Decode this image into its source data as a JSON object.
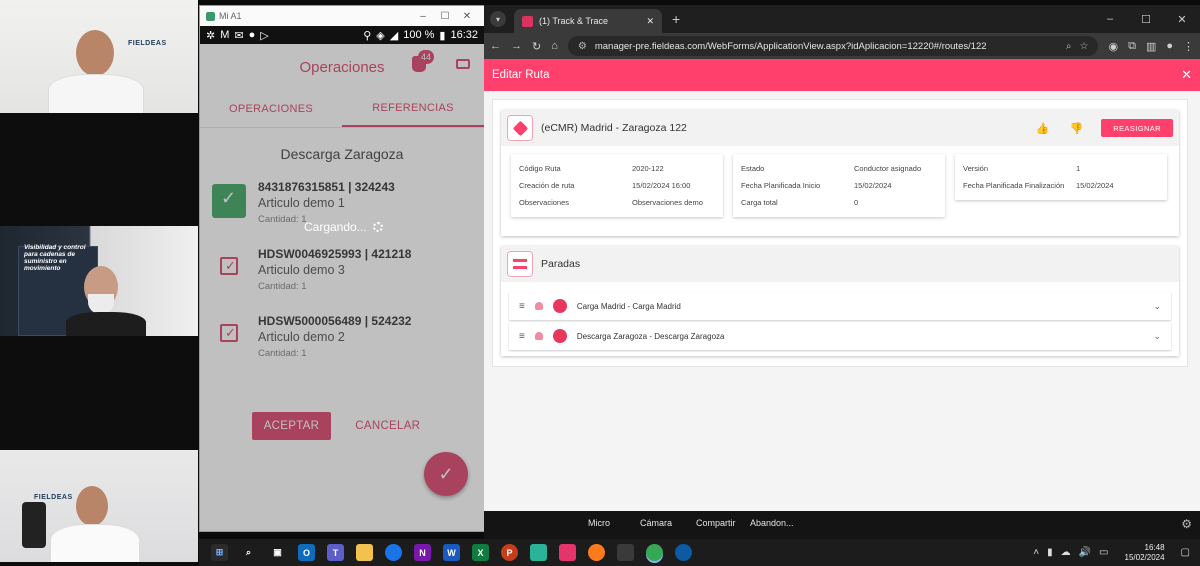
{
  "colors": {
    "accent": "#ff3f6c",
    "app_accent": "#d93460",
    "success": "#2f9e54"
  },
  "participants": [
    {
      "brand": "FIELDEAS"
    },
    {
      "poster_text": "Visibilidad y control para cadenas de suministro en movimiento"
    },
    {
      "brand": "FIELDEAS"
    }
  ],
  "phone_window": {
    "title": "Mi A1",
    "status": {
      "battery": "100 %",
      "time": "16:32"
    },
    "app": {
      "title": "Operaciones",
      "badge_count": "44",
      "tabs": [
        {
          "label": "OPERACIONES"
        },
        {
          "label": "REFERENCIAS"
        }
      ],
      "heading": "Descarga Zaragoza",
      "items": [
        {
          "code": "8431876315851 | 324243",
          "article": "Articulo demo 1",
          "qty": "Cantidad: 1",
          "checked_style": "green"
        },
        {
          "code": "HDSW0046925993 | 421218",
          "article": "Articulo demo 3",
          "qty": "Cantidad: 1",
          "checked_style": "outline"
        },
        {
          "code": "HDSW5000056489 | 524232",
          "article": "Articulo demo 2",
          "qty": "Cantidad: 1",
          "checked_style": "outline"
        }
      ],
      "loading": "Cargando...",
      "accept": "ACEPTAR",
      "cancel": "CANCELAR"
    }
  },
  "browser": {
    "tab_title": "(1) Track & Trace",
    "url": "manager-pre.fieldeas.com/WebForms/ApplicationView.aspx?idAplicacion=12220#/routes/122",
    "page": {
      "header_title": "Editar Ruta",
      "route": {
        "title": "(eCMR) Madrid - Zaragoza 122",
        "reassign": "REASIGNAR",
        "col1": [
          {
            "k": "Código Ruta",
            "v": "2020-122"
          },
          {
            "k": "Creación de ruta",
            "v": "15/02/2024 16:00"
          },
          {
            "k": "Observaciones",
            "v": "Observaciones demo"
          }
        ],
        "col2": [
          {
            "k": "Estado",
            "v": "Conductor asignado"
          },
          {
            "k": "Fecha Planificada Inicio",
            "v": "15/02/2024"
          },
          {
            "k": "Carga total",
            "v": "0"
          }
        ],
        "col3": [
          {
            "k": "Versión",
            "v": "1"
          },
          {
            "k": "Fecha Planificada Finalización",
            "v": "15/02/2024"
          }
        ]
      },
      "stops": {
        "title": "Paradas",
        "items": [
          {
            "label": "Carga Madrid - Carga Madrid"
          },
          {
            "label": "Descarga Zaragoza - Descarga Zaragoza"
          }
        ]
      }
    }
  },
  "meeting": {
    "mic": "Micro",
    "camera": "Cámara",
    "share": "Compartir",
    "leave": "Abandon..."
  },
  "taskbar": {
    "time": "16:48",
    "date": "15/02/2024"
  }
}
